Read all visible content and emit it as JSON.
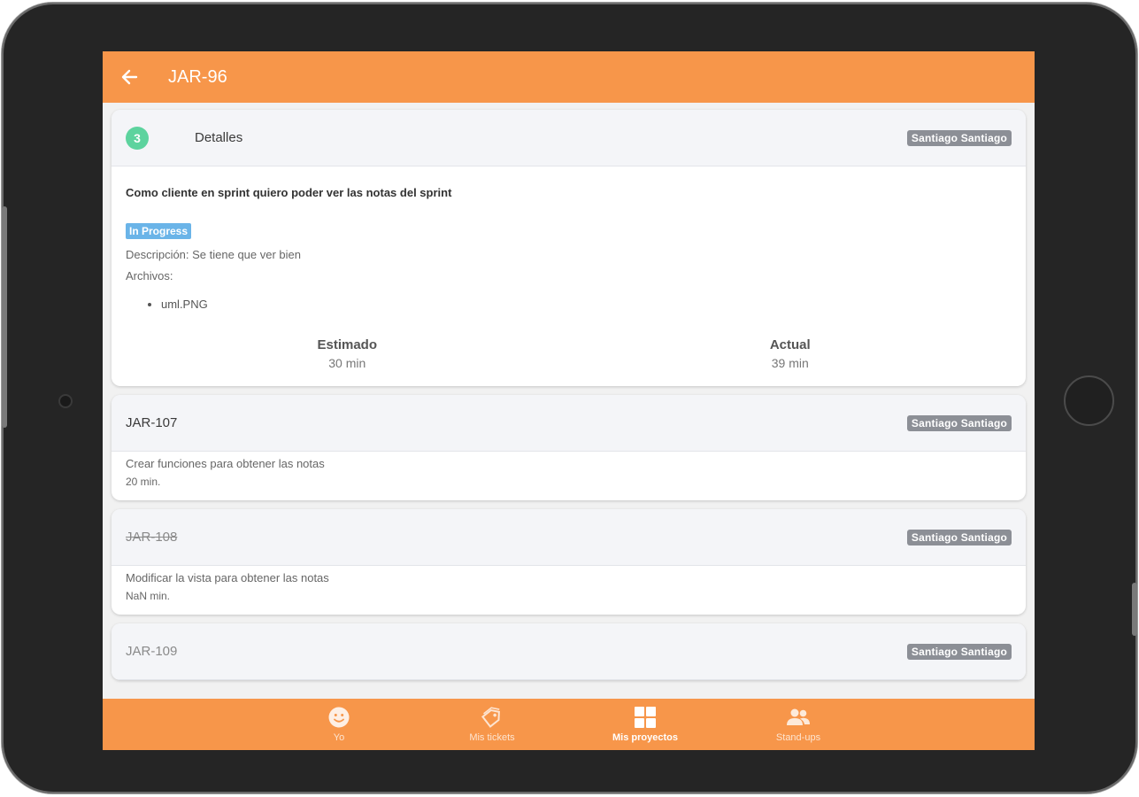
{
  "appbar": {
    "title": "JAR-96"
  },
  "details": {
    "count": "3",
    "label": "Detalles",
    "assignee": "Santiago Santiago",
    "story": "Como cliente en sprint quiero poder ver las notas del sprint",
    "status": "In Progress",
    "description": "Descripción: Se tiene que ver bien",
    "files_label": "Archivos:",
    "files": [
      "uml.PNG"
    ],
    "estimated_label": "Estimado",
    "estimated_value": "30 min",
    "actual_label": "Actual",
    "actual_value": "39 min"
  },
  "tasks": [
    {
      "id": "JAR-107",
      "assignee": "Santiago Santiago",
      "description": "Crear funciones para obtener las notas",
      "minutes": "20 min."
    },
    {
      "id": "JAR-108",
      "assignee": "Santiago Santiago",
      "description": "Modificar la vista para obtener las notas",
      "minutes": "NaN min."
    },
    {
      "id": "JAR-109",
      "assignee": "Santiago Santiago"
    }
  ],
  "tabs": [
    {
      "label": "Yo",
      "icon": "face-icon"
    },
    {
      "label": "Mis tickets",
      "icon": "tag-icon"
    },
    {
      "label": "Mis proyectos",
      "icon": "grid-icon"
    },
    {
      "label": "Stand-ups",
      "icon": "people-icon"
    }
  ],
  "colors": {
    "accent": "#f7964a",
    "badge": "#5dd39e",
    "status": "#6ab4e8",
    "chip": "#8c8f96"
  }
}
